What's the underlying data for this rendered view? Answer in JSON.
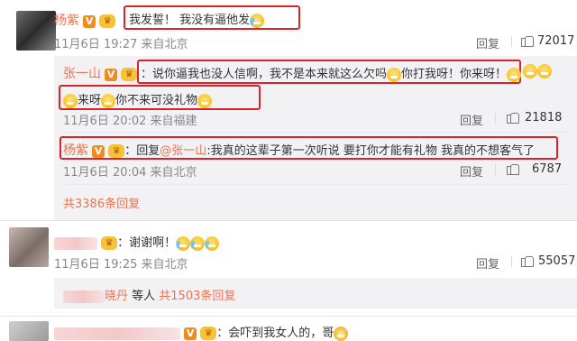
{
  "comment1": {
    "username": "杨紫",
    "v_badge": "V",
    "member_badge": "♛",
    "text": "我发誓！ 我没有逼他发",
    "emoji": "crying-laugh",
    "time": "11月6日 19:27 来自北京",
    "reply_label": "回复",
    "likes": "72017"
  },
  "reply1": {
    "username": "张一山",
    "v_badge": "V",
    "member_badge": "♛",
    "text_line1": "：说你逼我也没人信啊，我不是本来就这么欠吗",
    "text_mid": "你打我呀！你来呀！",
    "text_line2a": "来呀",
    "text_line2b": "你不来可没礼物",
    "time": "11月6日 20:02 来自福建",
    "reply_label": "回复",
    "likes": "21818"
  },
  "reply2": {
    "username": "杨紫",
    "v_badge": "V",
    "member_badge": "♛",
    "prefix": "：回复",
    "mention": "@张一山",
    "text": ":我真的这辈子第一次听说 要打你才能有礼物 我真的不想客气了",
    "time": "11月6日 20:04 来自北京",
    "reply_label": "回复",
    "likes": "6787"
  },
  "total_replies_1": "共3386条回复",
  "comment2": {
    "member_badge": "♛",
    "text": "：谢谢啊！",
    "time": "11月6日 19:25 来自北京",
    "reply_label": "回复",
    "likes": "55057"
  },
  "comment2_sub": {
    "name_partial": "晓丹",
    "text": " 等人 ",
    "total": "共1503条回复"
  },
  "comment3": {
    "v_badge": "V",
    "member_badge": "♛",
    "text": "：会吓到我女人的，哥"
  }
}
